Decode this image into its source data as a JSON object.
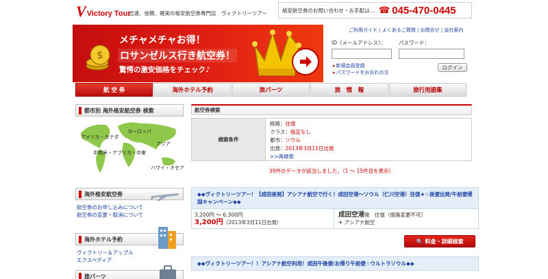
{
  "header": {
    "logo_mark": "V",
    "logo_text": "Victory Tour",
    "tagline": "迅速、信頼、確実の格安航空券専門店　ヴィクトリーツアー",
    "contact_label": "格安航空券のお問い合わせ・お手配は…",
    "phone": "045-470-0445"
  },
  "banner": {
    "line1": "メチャメチャお得！",
    "line2": "ロサンゼルス行き航空券！",
    "line3": "驚愕の激安価格をチェック♪"
  },
  "top_links": [
    "ご利用ガイド",
    "よくあるご質問",
    "お問合せ",
    "会社案内"
  ],
  "login": {
    "id_label": "ID（メールアドレス）：",
    "password_label": "パスワード：",
    "register_link": "新規会員登録",
    "forgot_link": "パスワードをお忘れの方",
    "login_button": "ログイン"
  },
  "nav": {
    "tabs": [
      "航 空 券",
      "海外ホテル予約",
      "旅パーツ",
      "旅　情　報",
      "旅行用語集"
    ],
    "active_index": 0
  },
  "sidebar": {
    "city_search_title": "都市別 海外格安航空券 検索",
    "map_labels": [
      "アメリカ・カナダ",
      "ヨーロッパ",
      "アジア",
      "中南米・アフリカ・中東",
      "ハワイ・オセアニア"
    ],
    "ticket_title": "海外格安航空券",
    "ticket_links": [
      "航空券のお申し込みについて",
      "航空券の変更・取消について"
    ],
    "hotel_title": "海外ホテル予約",
    "hotel_links": [
      "ヴィクトリー＆アップル",
      "エクスペディア"
    ],
    "parts_title": "旅パーツ"
  },
  "main": {
    "section_title": "航空券検索",
    "cond_label": "検索条件",
    "conditions": [
      {
        "label": "経路：",
        "value": "往復"
      },
      {
        "label": "クラス：",
        "value": "指定なし"
      },
      {
        "label": "都市：",
        "value": "ソウル"
      },
      {
        "label": "出発：",
        "value": "2013年3月11日出発"
      }
    ],
    "research_link": ">>再検索",
    "result_count": "39件のデータが該当しました。（1 ～ 15件目を表示）",
    "result1": {
      "title": "◆◆ヴィクトリーツアー！【成田夜発】アシアナ航空で行く！成田空港～ソウル（仁川空港）往復★☆夜便出発/午前便帰国キャンペーン◆◆",
      "price_range": "3,200円 ～ 6,300円",
      "price": "3,200円",
      "price_date": "（2013年3月11日出発）",
      "origin": "成田空港",
      "origin_suffix": "発　往復（復路変更不可）",
      "airline": "アシアナ航空",
      "detail_button": "料金・詳細検索"
    },
    "result2": {
      "title": "◆◆ヴィクトリーツアー！！アシアナ航空利用！成田午後便/お帰り午前便☆ウルトラソウル◆◆"
    }
  },
  "colors": {
    "brand_red": "#c40d0d",
    "link_blue": "#1a3fa0",
    "card_blue": "#e3eef8"
  }
}
